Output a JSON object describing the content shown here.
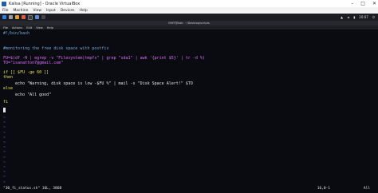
{
  "host_window": {
    "title": "Kalisa [Running] - Oracle VirtualBox",
    "controls": [
      "–",
      "□",
      "✕"
    ]
  },
  "host_menu": [
    "File",
    "Machine",
    "View",
    "Input",
    "Devices",
    "Help"
  ],
  "guest_panel": {
    "clock": "20:07"
  },
  "terminal": {
    "title": "ISMT@kali: ~/Desktop/scripts",
    "menu": [
      "File",
      "Actions",
      "Edit",
      "View",
      "Help"
    ]
  },
  "editor": {
    "lines": [
      "#!/bin/bash",
      "",
      "",
      "#monitoring the free disk space with postfix",
      "",
      "FU=$(df -H | egrep -v \"Filesystem|tmpfs\" | grep \"sda1\" | awk '{print $5}' | tr -d %)",
      "TO=\"isanatton7@gmail.com\"",
      "",
      "if [[ $FU -ge 60 ]]",
      "then",
      "     echo \"Warning, disk space is low -$FU %\" | mail -s \"Disk Space Alert!\" $TO",
      "else",
      "     echo \"All good\"",
      "fi"
    ],
    "tilde_count": 14,
    "status_file": "\"30_fi_status.sh\" 16L, 386B",
    "status_pos": "16,0-1",
    "status_scroll": "All"
  },
  "colors": {
    "comment": "#6fa8dc",
    "variable": "#e06cff",
    "string": "#ff6b6b",
    "keyword": "#e8e14a",
    "tilde": "#4a6bd6"
  }
}
